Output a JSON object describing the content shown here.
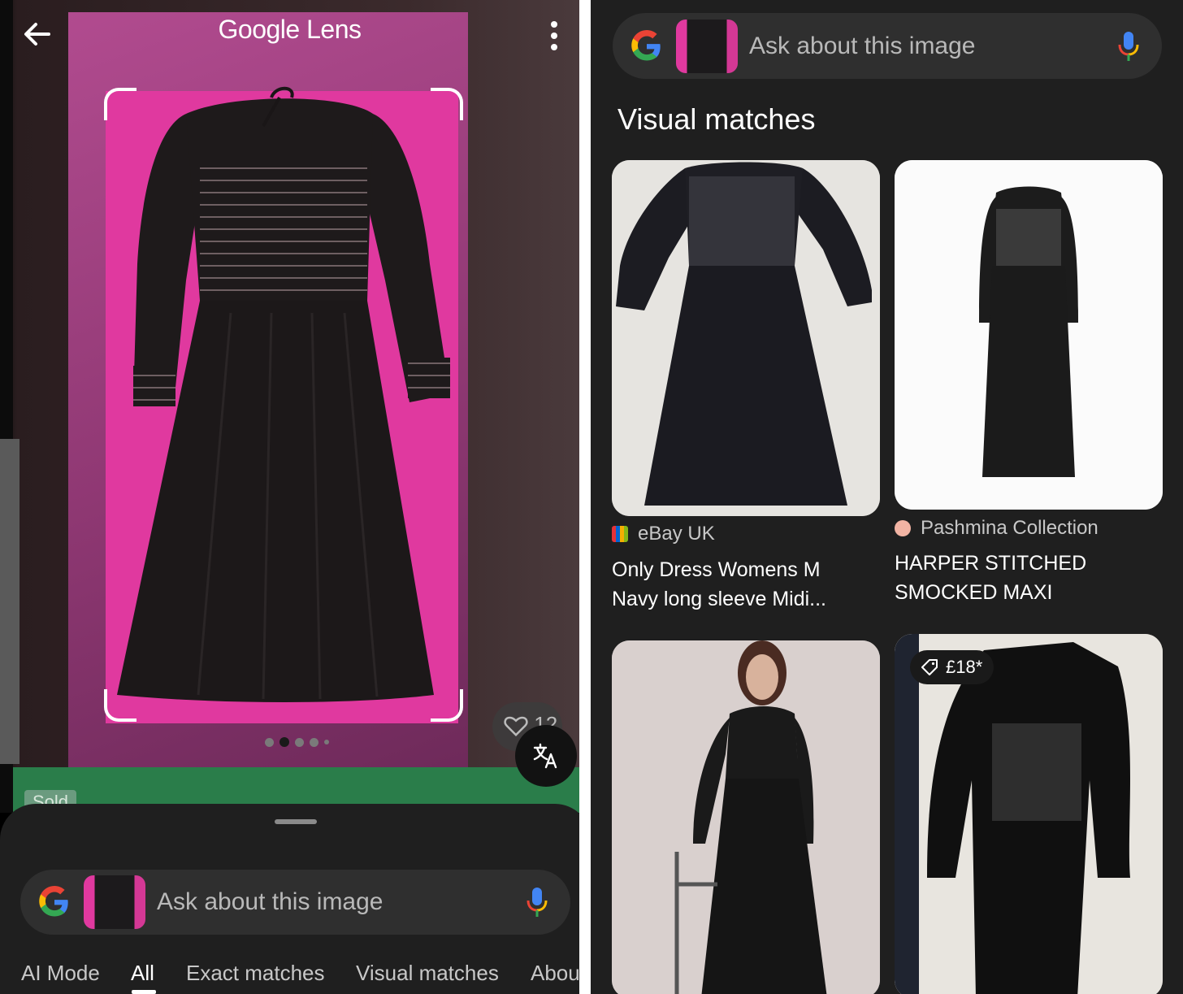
{
  "lens": {
    "title": "Google Lens",
    "sold_tag": "Sold",
    "likes_count": "12",
    "carousel": {
      "total": 5,
      "active_index": 1
    }
  },
  "search": {
    "placeholder": "Ask about this image"
  },
  "tabs": [
    {
      "label": "AI Mode",
      "active": false
    },
    {
      "label": "All",
      "active": true
    },
    {
      "label": "Exact matches",
      "active": false
    },
    {
      "label": "Visual matches",
      "active": false
    },
    {
      "label": "About",
      "active": false
    }
  ],
  "results": {
    "heading": "Visual matches",
    "items": [
      {
        "source": "eBay UK",
        "title_line1": "Only Dress Womens M",
        "title_line2": "Navy long sleeve Midi..."
      },
      {
        "source": "Pashmina Collection",
        "title_line1": "HARPER STITCHED",
        "title_line2": "SMOCKED MAXI"
      },
      {
        "source": "",
        "title_line1": "",
        "title_line2": ""
      },
      {
        "source": "",
        "price": "£18*"
      }
    ]
  },
  "icons": {
    "back": "arrow-left-icon",
    "more": "more-vert-icon",
    "translate": "translate-icon",
    "google": "google-g-icon",
    "mic": "mic-icon",
    "heart": "heart-icon",
    "price_tag": "tag-icon"
  },
  "colors": {
    "background_dark": "#1f1f1f",
    "search_bar": "#2f2f2f",
    "mat_pink": "#e0399f",
    "sold_green": "#2a7d4a"
  }
}
